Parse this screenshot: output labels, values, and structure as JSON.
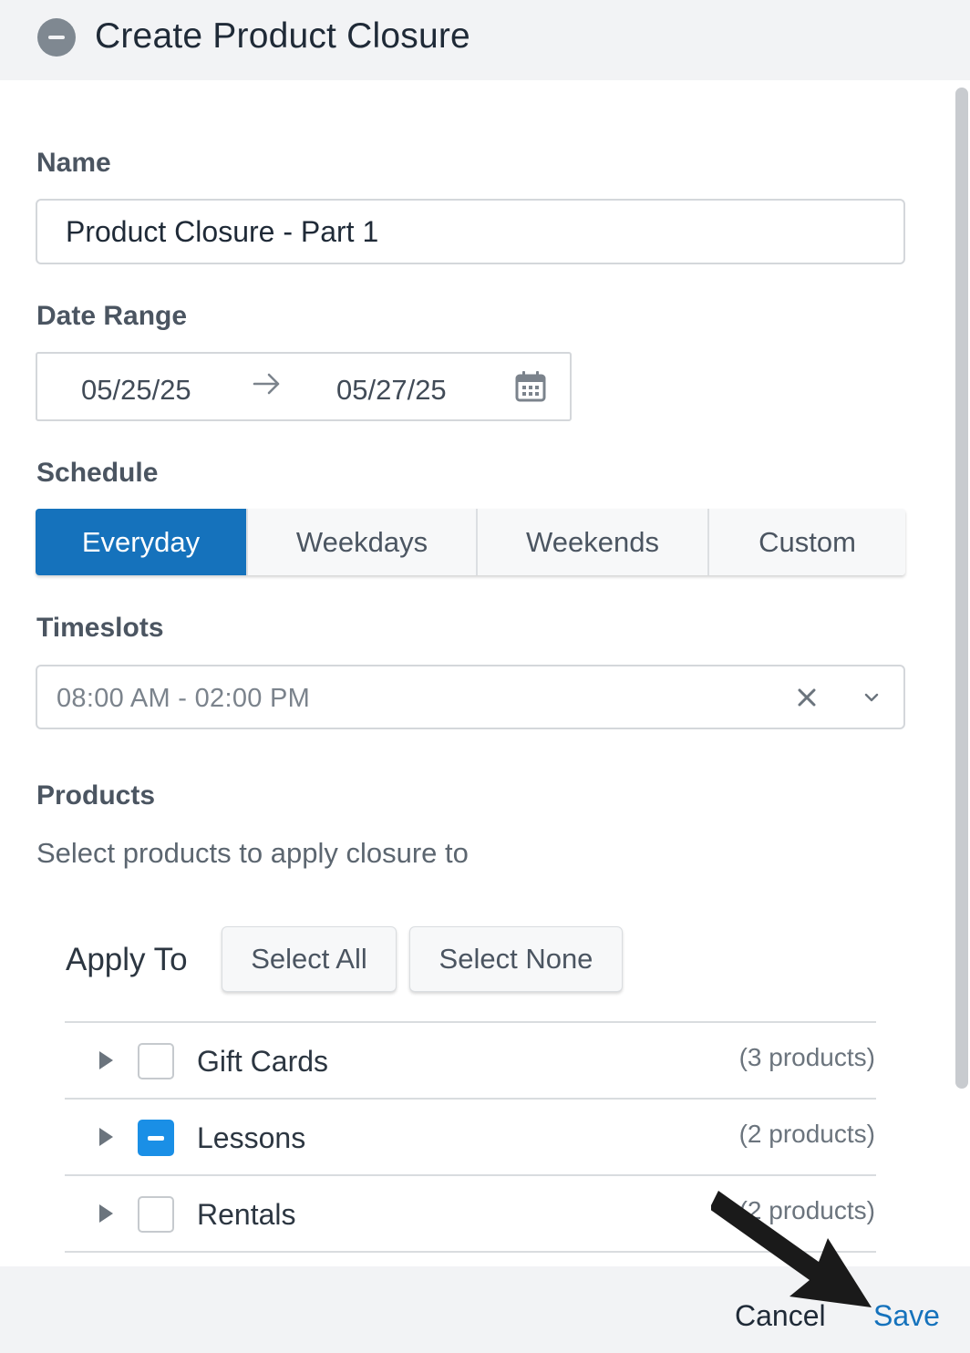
{
  "header": {
    "title": "Create Product Closure",
    "icon": "minus-circle-icon"
  },
  "name_field": {
    "label": "Name",
    "value": "Product Closure - Part 1"
  },
  "date_range": {
    "label": "Date Range",
    "start": "05/25/25",
    "end": "05/27/25"
  },
  "schedule": {
    "label": "Schedule",
    "options": [
      "Everyday",
      "Weekdays",
      "Weekends",
      "Custom"
    ],
    "selected": "Everyday"
  },
  "timeslots": {
    "label": "Timeslots",
    "value": "08:00 AM - 02:00 PM"
  },
  "products": {
    "label": "Products",
    "subtitle": "Select products to apply closure to",
    "apply_to_label": "Apply To",
    "select_all": "Select All",
    "select_none": "Select None",
    "rows": [
      {
        "name": "Gift Cards",
        "count": "(3 products)",
        "state": "unchecked"
      },
      {
        "name": "Lessons",
        "count": "(2 products)",
        "state": "partial"
      },
      {
        "name": "Rentals",
        "count": "(2 products)",
        "state": "unchecked"
      }
    ]
  },
  "footer": {
    "cancel": "Cancel",
    "save": "Save"
  },
  "colors": {
    "accent": "#1572bc",
    "checkbox_partial": "#1a8fe6"
  }
}
